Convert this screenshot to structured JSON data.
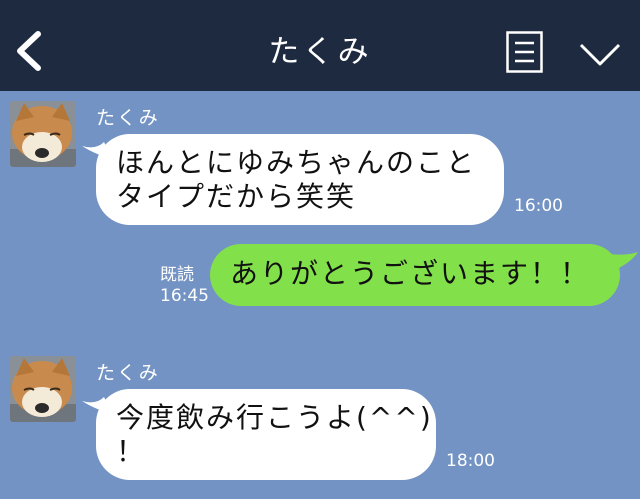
{
  "header": {
    "title": "たくみ",
    "back_icon": "chevron-left-icon",
    "menu_icon": "menu-icon",
    "collapse_icon": "chevron-down-icon"
  },
  "messages": [
    {
      "sender": "たくみ",
      "lines": [
        "ほんとにゆみちゃんのこと",
        "タイプだから笑笑"
      ],
      "time": "16:00"
    },
    {
      "read": "既読",
      "time": "16:45",
      "text": "ありがとうございます！！"
    },
    {
      "sender": "たくみ",
      "lines": [
        "今度飲み行こうよ(^^)",
        "！"
      ],
      "time": "18:00"
    }
  ],
  "colors": {
    "header_bg": "#1e2a40",
    "chat_bg": "#7293c4",
    "incoming_bubble": "#ffffff",
    "outgoing_bubble": "#82e04a"
  }
}
